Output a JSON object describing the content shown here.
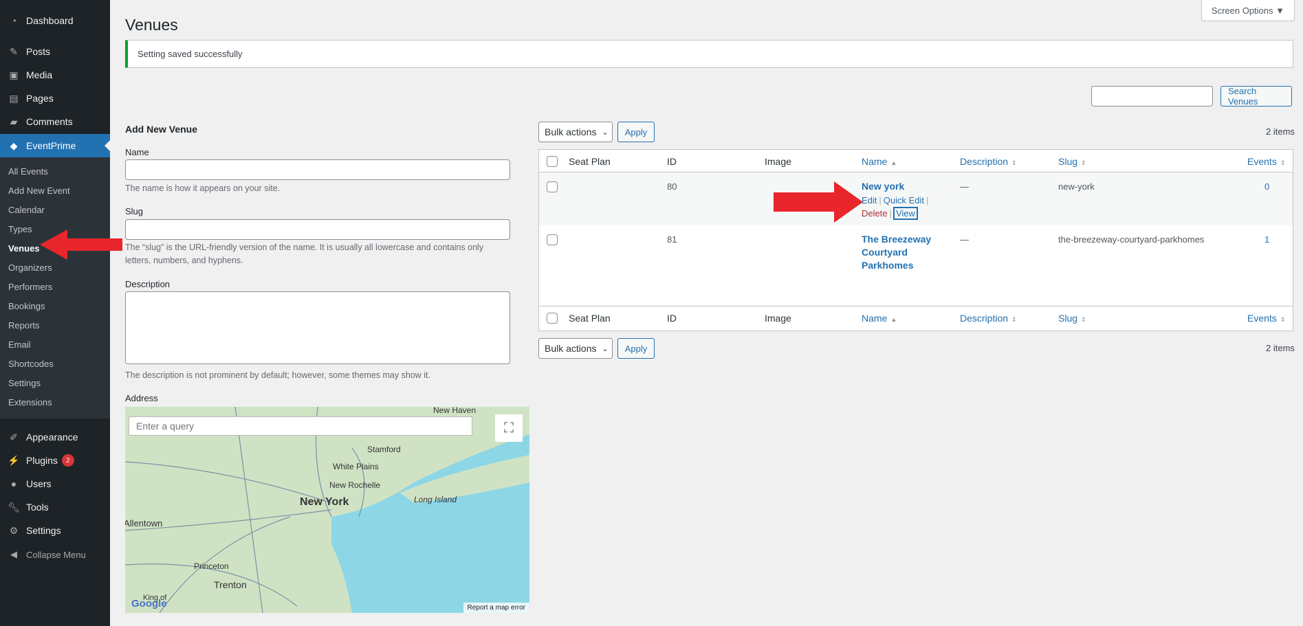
{
  "sidebar": {
    "top_items": [
      {
        "label": "Dashboard",
        "icon": "dashboard-icon"
      },
      {
        "label": "Posts",
        "icon": "pin-icon"
      },
      {
        "label": "Media",
        "icon": "media-icon"
      },
      {
        "label": "Pages",
        "icon": "pages-icon"
      },
      {
        "label": "Comments",
        "icon": "comment-icon"
      },
      {
        "label": "EventPrime",
        "icon": "ticket-icon"
      }
    ],
    "submenu": [
      "All Events",
      "Add New Event",
      "Calendar",
      "Types",
      "Venues",
      "Organizers",
      "Performers",
      "Bookings",
      "Reports",
      "Email",
      "Shortcodes",
      "Settings",
      "Extensions"
    ],
    "bottom_items": [
      {
        "label": "Appearance",
        "icon": "brush-icon"
      },
      {
        "label": "Plugins",
        "icon": "plugin-icon",
        "badge": "2"
      },
      {
        "label": "Users",
        "icon": "users-icon"
      },
      {
        "label": "Tools",
        "icon": "wrench-icon"
      },
      {
        "label": "Settings",
        "icon": "settings-icon"
      },
      {
        "label": "Collapse Menu",
        "icon": "collapse-icon"
      }
    ]
  },
  "header": {
    "title": "Venues",
    "screen_options": "Screen Options ▼"
  },
  "notice": "Setting saved successfully",
  "search": {
    "button": "Search Venues"
  },
  "form": {
    "heading": "Add New Venue",
    "name_label": "Name",
    "name_desc": "The name is how it appears on your site.",
    "slug_label": "Slug",
    "slug_desc_1": "The “slug” is the URL-friendly version of the name. It is usually all lowercase and contains only",
    "slug_desc_2": "letters, numbers, and hyphens.",
    "desc_label": "Description",
    "desc_desc": "The description is not prominent by default; however, some themes may show it.",
    "address_label": "Address"
  },
  "map": {
    "placeholder": "Enter a query",
    "report": "Report a map error",
    "labels": [
      "New Haven",
      "Stamford",
      "White Plains",
      "New Rochelle",
      "New York",
      "Long Island",
      "Allentown",
      "Princeton",
      "Trenton",
      "King of",
      "Google"
    ]
  },
  "list": {
    "bulk_label": "Bulk actions",
    "apply": "Apply",
    "count": "2 items",
    "columns": [
      "Seat Plan",
      "ID",
      "Image",
      "Name",
      "Description",
      "Slug",
      "Events"
    ],
    "rows": [
      {
        "id": "80",
        "name": "New york",
        "description": "—",
        "slug": "new-york",
        "events": "0",
        "actions": [
          "Edit",
          "Quick Edit",
          "Delete",
          "View"
        ]
      },
      {
        "id": "81",
        "name_lines": [
          "The Breezeway",
          "Courtyard",
          "Parkhomes"
        ],
        "description": "—",
        "slug": "the-breezeway-courtyard-parkhomes",
        "events": "1"
      }
    ]
  },
  "colors": {
    "sidebar": "#1d2327",
    "accent": "#2271b1",
    "arrow": "#e8262b"
  }
}
